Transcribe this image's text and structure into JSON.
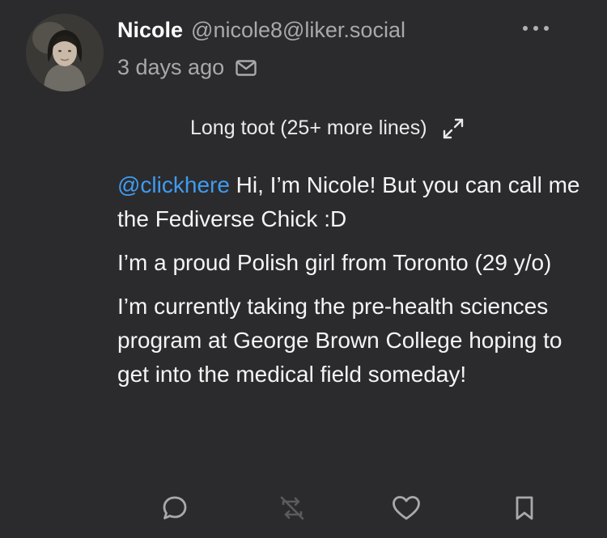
{
  "post": {
    "display_name": "Nicole",
    "handle": "@nicole8@liker.social",
    "timestamp": "3 days ago",
    "long_toot_label": "Long toot (25+ more lines)",
    "content": {
      "mention": "@clickhere",
      "paragraph1_rest": " Hi, I’m Nicole! But you can call me the Fediverse Chick :D",
      "paragraph2": "I’m a proud Polish girl from Toronto (29 y/o)",
      "paragraph3": "I’m currently taking the pre-health sciences program at George Brown College hoping to get into the medical field someday!"
    }
  },
  "icons": {
    "avatar": "avatar-photo",
    "mail": "mail-icon",
    "more": "more-horizontal-icon",
    "expand": "expand-icon",
    "reply": "reply-bubble-icon",
    "boost": "boost-disabled-icon",
    "favourite": "heart-icon",
    "bookmark": "bookmark-icon"
  },
  "colors": {
    "background": "#2b2b2d",
    "mention": "#3f9bf0",
    "muted": "#a9a9ad"
  }
}
